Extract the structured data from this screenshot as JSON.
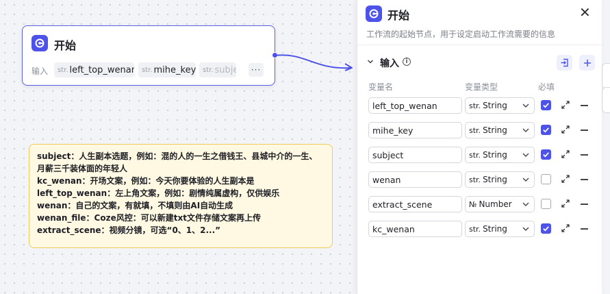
{
  "colors": {
    "accent": "#4d53e8",
    "note_border": "#f4c95a",
    "note_bg": "#fff9e3"
  },
  "node": {
    "title": "开始",
    "input_label": "输入",
    "chips": [
      {
        "type": "str.",
        "name": "left_top_wenan"
      },
      {
        "type": "str.",
        "name": "mihe_key"
      },
      {
        "type": "str.",
        "name": "subje"
      }
    ],
    "more": "···"
  },
  "note": {
    "lines": [
      "subject：人生副本选题，例如：混的人的一生之借钱王、县城中介的一生、",
      "月薪三千装体面的年轻人",
      "kc_wenan：开场文案，例如：今天你要体验的人生副本是",
      "left_top_wenan：左上角文案，例如：剧情纯属虚构，仅供娱乐",
      "wenan：自己的文案，有就填，不填则由AI自动生成",
      "wenan_file：Coze风控：可以新建txt文件存储文案再上传",
      "extract_scene：视频分镜，可选“0、1、2...”"
    ]
  },
  "panel": {
    "title": "开始",
    "close": "✕",
    "description": "工作流的起始节点，用于设定启动工作流需要的信息",
    "section": {
      "title": "输入",
      "toggle": "⌄",
      "info": "i"
    },
    "columns": {
      "name": "变量名",
      "type": "变量类型",
      "required": "必填"
    },
    "rows": [
      {
        "name": "left_top_wenan",
        "type_icon": "str.",
        "type": "String",
        "required": true
      },
      {
        "name": "mihe_key",
        "type_icon": "str.",
        "type": "String",
        "required": true
      },
      {
        "name": "subject",
        "type_icon": "str.",
        "type": "String",
        "required": true
      },
      {
        "name": "wenan",
        "type_icon": "str.",
        "type": "String",
        "required": false
      },
      {
        "name": "extract_scene",
        "type_icon": "№",
        "type": "Number",
        "required": false
      },
      {
        "name": "kc_wenan",
        "type_icon": "str.",
        "type": "String",
        "required": true
      }
    ]
  }
}
